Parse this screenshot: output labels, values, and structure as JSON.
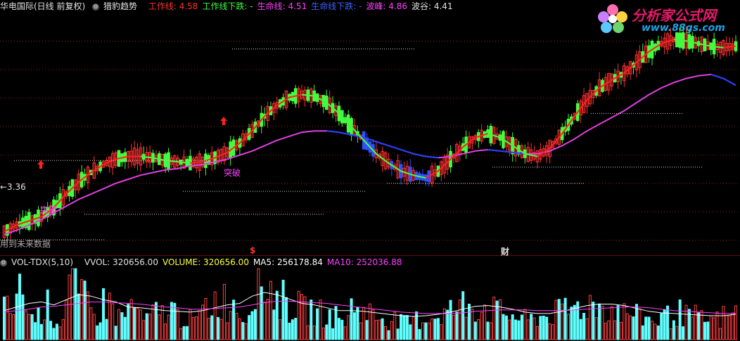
{
  "header": {
    "stock_title": "华电国际(日线 前复权)",
    "indicator_name": "猎豹趋势",
    "items": [
      {
        "label": "工作线: 4.58",
        "color": "#ff3030"
      },
      {
        "label": "工作线下跌: -",
        "color": "#40ff40"
      },
      {
        "label": "生命线: 4.51",
        "color": "#ff40ff"
      },
      {
        "label": "生命线下跌: -",
        "color": "#4060ff"
      },
      {
        "label": "波峰: 4.86",
        "color": "#ff40ff"
      },
      {
        "label": "波谷: 4.41",
        "color": "#e0e0e0"
      }
    ]
  },
  "volume_header": {
    "name": "VOL-TDX(5,10)",
    "items": [
      {
        "label": "VVOL: 320656.00",
        "color": "#e0e0e0"
      },
      {
        "label": "VOLUME: 320656.00",
        "color": "#ffff40"
      },
      {
        "label": "MA5: 256178.84",
        "color": "#ffffff"
      },
      {
        "label": "MA10: 252036.88",
        "color": "#ff40ff"
      }
    ]
  },
  "annotations": {
    "low_price": "←3.36",
    "breakout_1": "突破",
    "breakout_2": "突破",
    "future_note": "用到未来数据",
    "marker_dollar": "$",
    "marker_cai": "财"
  },
  "logo": {
    "title": "分析家公式网",
    "url": "www.88gs.com"
  },
  "colors": {
    "up": "#ff3030",
    "down_green": "#40ff40",
    "down_blue": "#3050ff",
    "work_line": "#ff2020",
    "work_line_down": "#40ff40",
    "life_line": "#e040e0",
    "life_line_down": "#2040ff",
    "grid": "#a01818",
    "vol_up": "#ff4040",
    "vol_down": "#60ffff",
    "ma5": "#ffffff",
    "ma10": "#ff40ff"
  },
  "chart_data": {
    "type": "line",
    "series": [
      {
        "name": "工作线",
        "values": [
          3.42,
          3.47,
          3.5,
          3.53,
          3.6,
          3.7,
          3.79,
          3.86,
          3.92,
          3.96,
          3.98,
          3.98,
          3.97,
          3.95,
          3.94,
          3.93,
          3.94,
          3.97,
          4.01,
          4.08,
          4.17,
          4.28,
          4.36,
          4.42,
          4.44,
          4.43,
          4.38,
          4.3,
          4.2,
          4.1,
          4.0,
          3.93,
          3.87,
          3.84,
          3.82,
          3.87,
          3.96,
          4.05,
          4.12,
          4.15,
          4.12,
          4.06,
          4.0,
          3.98,
          4.04,
          4.15,
          4.28,
          4.4,
          4.49,
          4.55,
          4.6,
          4.68,
          4.76,
          4.82,
          4.85,
          4.84,
          4.82,
          4.8,
          4.79,
          4.8
        ]
      },
      {
        "name": "生命线",
        "values": [
          3.4,
          3.43,
          3.47,
          3.51,
          3.56,
          3.61,
          3.66,
          3.7,
          3.74,
          3.78,
          3.81,
          3.84,
          3.86,
          3.88,
          3.89,
          3.91,
          3.92,
          3.94,
          3.96,
          3.99,
          4.02,
          4.06,
          4.1,
          4.13,
          4.16,
          4.17,
          4.17,
          4.16,
          4.14,
          4.12,
          4.09,
          4.06,
          4.03,
          4.0,
          3.98,
          3.97,
          3.98,
          4.0,
          4.02,
          4.03,
          4.02,
          4.01,
          4.0,
          4.0,
          4.02,
          4.06,
          4.11,
          4.17,
          4.22,
          4.27,
          4.32,
          4.38,
          4.44,
          4.49,
          4.53,
          4.56,
          4.58,
          4.59,
          4.56,
          4.51
        ]
      },
      {
        "name": "VOLUME",
        "values": [
          0.45,
          0.7,
          0.35,
          0.5,
          0.3,
          0.9,
          0.6,
          0.4,
          0.55,
          0.35,
          0.5,
          0.3,
          0.4,
          0.45,
          0.35,
          0.3,
          0.5,
          0.6,
          0.55,
          0.4,
          0.95,
          0.8,
          0.6,
          0.5,
          0.45,
          0.4,
          0.35,
          0.3,
          0.5,
          0.4,
          0.35,
          0.3,
          0.25,
          0.3,
          0.35,
          0.4,
          0.45,
          0.55,
          0.5,
          0.45,
          0.4,
          0.35,
          0.3,
          0.35,
          0.4,
          0.45,
          0.5,
          0.55,
          0.5,
          0.45,
          0.4,
          0.35,
          0.3,
          0.35,
          0.4,
          0.35,
          0.3,
          0.3,
          0.35,
          0.4
        ]
      },
      {
        "name": "MA5",
        "values": [
          0.4,
          0.45,
          0.5,
          0.52,
          0.48,
          0.55,
          0.62,
          0.6,
          0.55,
          0.52,
          0.45,
          0.44,
          0.42,
          0.4,
          0.39,
          0.38,
          0.4,
          0.44,
          0.48,
          0.5,
          0.6,
          0.65,
          0.62,
          0.56,
          0.5,
          0.48,
          0.44,
          0.4,
          0.4,
          0.39,
          0.37,
          0.35,
          0.33,
          0.32,
          0.33,
          0.35,
          0.38,
          0.42,
          0.46,
          0.47,
          0.45,
          0.42,
          0.38,
          0.36,
          0.36,
          0.39,
          0.43,
          0.47,
          0.49,
          0.49,
          0.47,
          0.43,
          0.39,
          0.37,
          0.36,
          0.35,
          0.34,
          0.33,
          0.33,
          0.35
        ]
      },
      {
        "name": "MA10",
        "values": [
          0.38,
          0.4,
          0.42,
          0.45,
          0.46,
          0.48,
          0.5,
          0.52,
          0.52,
          0.51,
          0.5,
          0.49,
          0.47,
          0.45,
          0.44,
          0.42,
          0.42,
          0.43,
          0.44,
          0.45,
          0.48,
          0.51,
          0.53,
          0.53,
          0.52,
          0.51,
          0.5,
          0.48,
          0.46,
          0.44,
          0.42,
          0.4,
          0.38,
          0.37,
          0.36,
          0.36,
          0.36,
          0.37,
          0.39,
          0.4,
          0.41,
          0.41,
          0.41,
          0.4,
          0.4,
          0.4,
          0.41,
          0.42,
          0.43,
          0.44,
          0.45,
          0.45,
          0.44,
          0.42,
          0.4,
          0.39,
          0.38,
          0.37,
          0.36,
          0.36
        ]
      }
    ],
    "price_ylim": [
      3.25,
      5.05
    ],
    "volume_ylim": [
      0,
      1.0
    ],
    "low_marker": 3.36,
    "peak": 4.86,
    "trough": 4.41
  }
}
